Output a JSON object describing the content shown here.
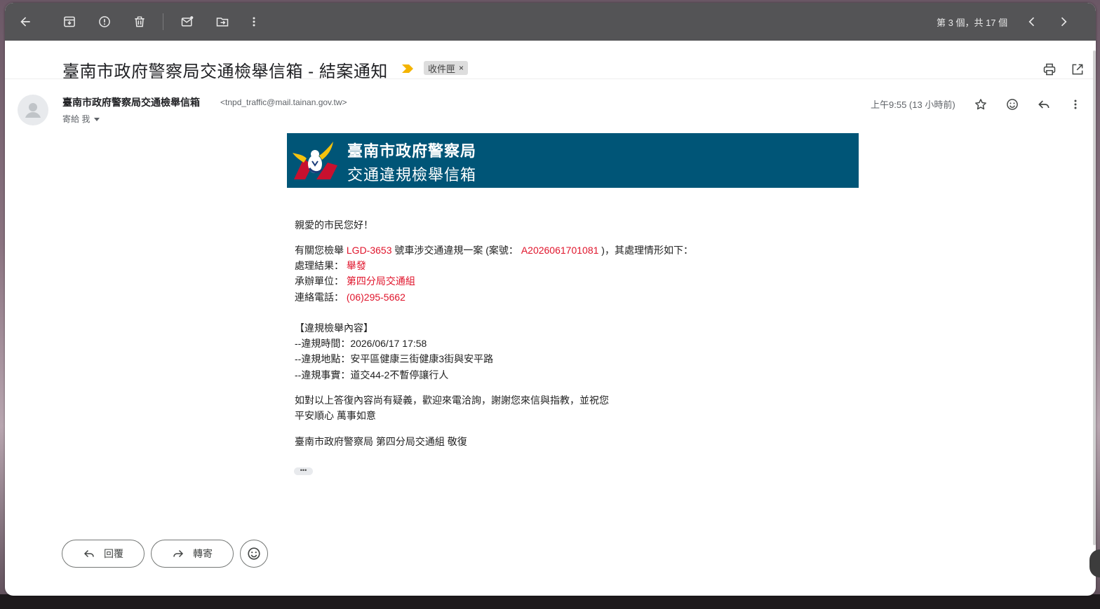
{
  "toolbar": {
    "pager_text": "第 3 個，共 17 個",
    "icons": [
      "back-arrow-icon",
      "archive-icon",
      "report-spam-icon",
      "delete-icon",
      "mark-unread-icon",
      "move-to-icon",
      "more-vert-icon",
      "prev-chevron-icon",
      "next-chevron-icon"
    ]
  },
  "email": {
    "subject": "臺南市政府警察局交通檢舉信箱 - 結案通知",
    "label": "收件匣",
    "label_close": "×",
    "sender_name": "臺南市政府警察局交通檢舉信箱",
    "sender_email": "<tnpd_traffic@mail.tainan.gov.tw>",
    "to": "寄給 我",
    "timestamp": "上午9:55 (13 小時前)"
  },
  "banner": {
    "line1": "臺南市政府警察局",
    "line2": "交通違規檢舉信箱",
    "bg_color": "#005577"
  },
  "body": {
    "greeting": "親愛的市民您好！",
    "intro_prefix": "有關您檢舉",
    "plate": "LGD-3653",
    "intro_middle": "號車涉交通違規一案 (案號：",
    "case_no": "A2026061701081",
    "intro_suffix": ")，其處理情形如下：",
    "result_label": "處理結果：",
    "result_value": "舉發",
    "unit_label": "承辦單位：",
    "unit_value": "第四分局交通組",
    "phone_label": "連絡電話：",
    "phone_value": "(06)295-5662",
    "section_title": "【違規檢舉內容】",
    "time_line": "--違規時間：2026/06/17 17:58",
    "place_line": "--違規地點：安平區健康三街健康3街與安平路",
    "fact_line": "--違規事實：道交44-2不暫停讓行人",
    "closing1": "如對以上答復內容尚有疑義，歡迎來電洽詢，謝謝您來信與指教，並祝您",
    "closing2": "平安順心 萬事如意",
    "signature": "臺南市政府警察局 第四分局交通組 敬復",
    "ellipsis": "•••",
    "highlight_color": "#e0142b"
  },
  "actions": {
    "reply": "回覆",
    "forward": "轉寄"
  }
}
